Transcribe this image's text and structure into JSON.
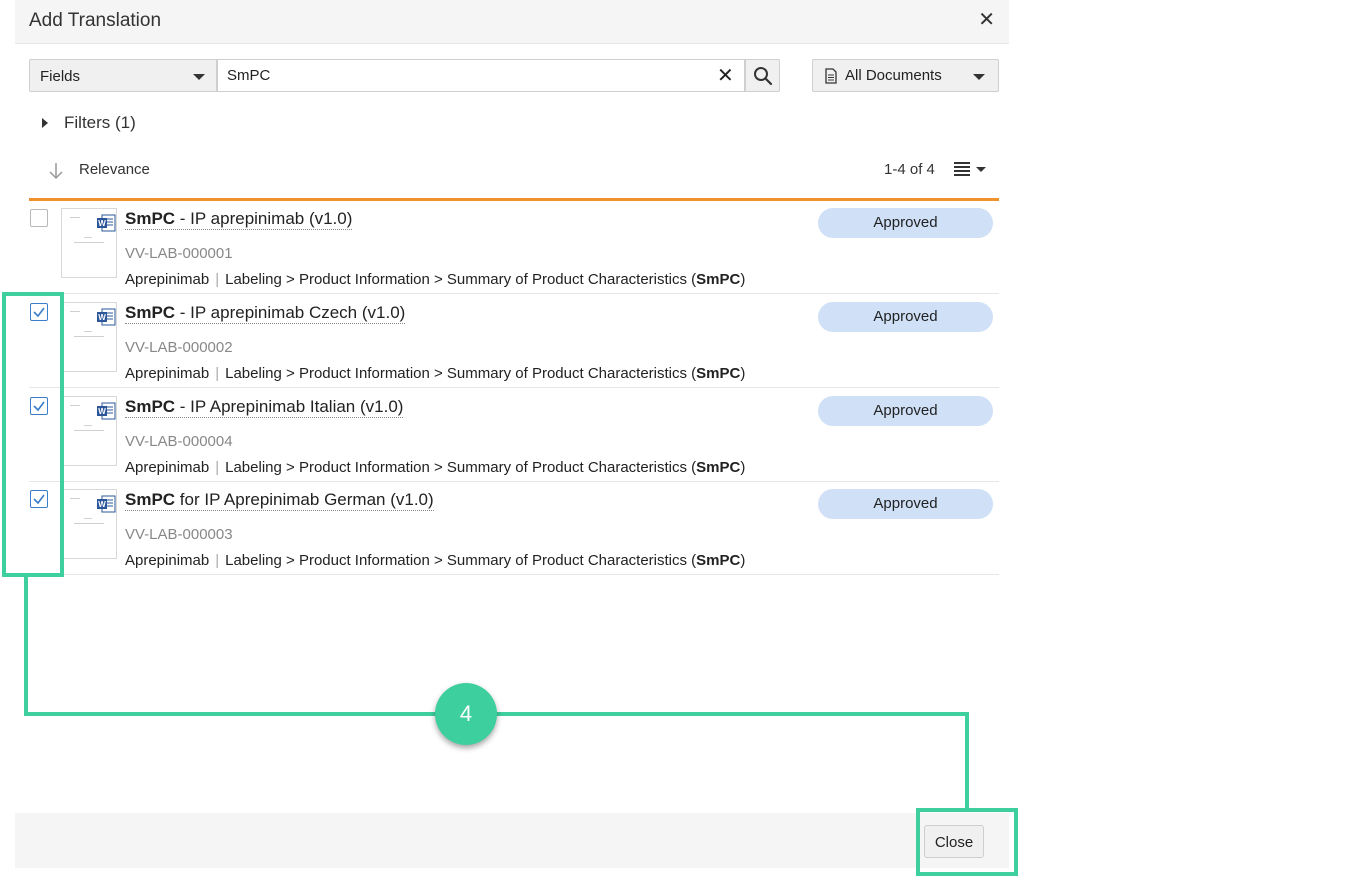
{
  "dialog": {
    "title": "Add Translation",
    "close_icon": "close-icon"
  },
  "search": {
    "scope_label": "Fields",
    "query": "SmPC",
    "clear_icon": "clear-icon",
    "search_icon": "search-icon",
    "documents_label": "All Documents",
    "documents_icon": "document-icon"
  },
  "filters": {
    "label": "Filters (1)"
  },
  "sort": {
    "label": "Relevance",
    "icon": "arrow-down-icon"
  },
  "results": {
    "count": "1-4 of 4",
    "view_icon": "list-view-icon",
    "items": [
      {
        "title_bold": "SmPC",
        "title_rest": " - IP aprepinimab (v1.0)",
        "number": "VV-LAB-000001",
        "product": "Aprepinimab",
        "path": "Labeling > Product Information > Summary of Product Characteristics (",
        "path_bold": "SmPC",
        "path_end": ")",
        "status": "Approved",
        "checked": false
      },
      {
        "title_bold": "SmPC",
        "title_rest": " - IP aprepinimab Czech (v1.0)",
        "number": "VV-LAB-000002",
        "product": "Aprepinimab",
        "path": "Labeling > Product Information > Summary of Product Characteristics (",
        "path_bold": "SmPC",
        "path_end": ")",
        "status": "Approved",
        "checked": true
      },
      {
        "title_bold": "SmPC",
        "title_rest": " - IP Aprepinimab Italian (v1.0)",
        "number": "VV-LAB-000004",
        "product": "Aprepinimab",
        "path": "Labeling > Product Information > Summary of Product Characteristics (",
        "path_bold": "SmPC",
        "path_end": ")",
        "status": "Approved",
        "checked": true
      },
      {
        "title_bold": "SmPC",
        "title_rest": " for IP Aprepinimab German (v1.0)",
        "number": "VV-LAB-000003",
        "product": "Aprepinimab",
        "path": "Labeling > Product Information > Summary of Product Characteristics (",
        "path_bold": "SmPC",
        "path_end": ")",
        "status": "Approved",
        "checked": true
      }
    ]
  },
  "footer": {
    "close_label": "Close"
  },
  "annotation": {
    "step_number": "4",
    "color": "#3ecf9e"
  },
  "colors": {
    "accent_rule": "#f0922b",
    "status_pill": "#cfe0f7",
    "checkbox": "#3b7ec9"
  }
}
